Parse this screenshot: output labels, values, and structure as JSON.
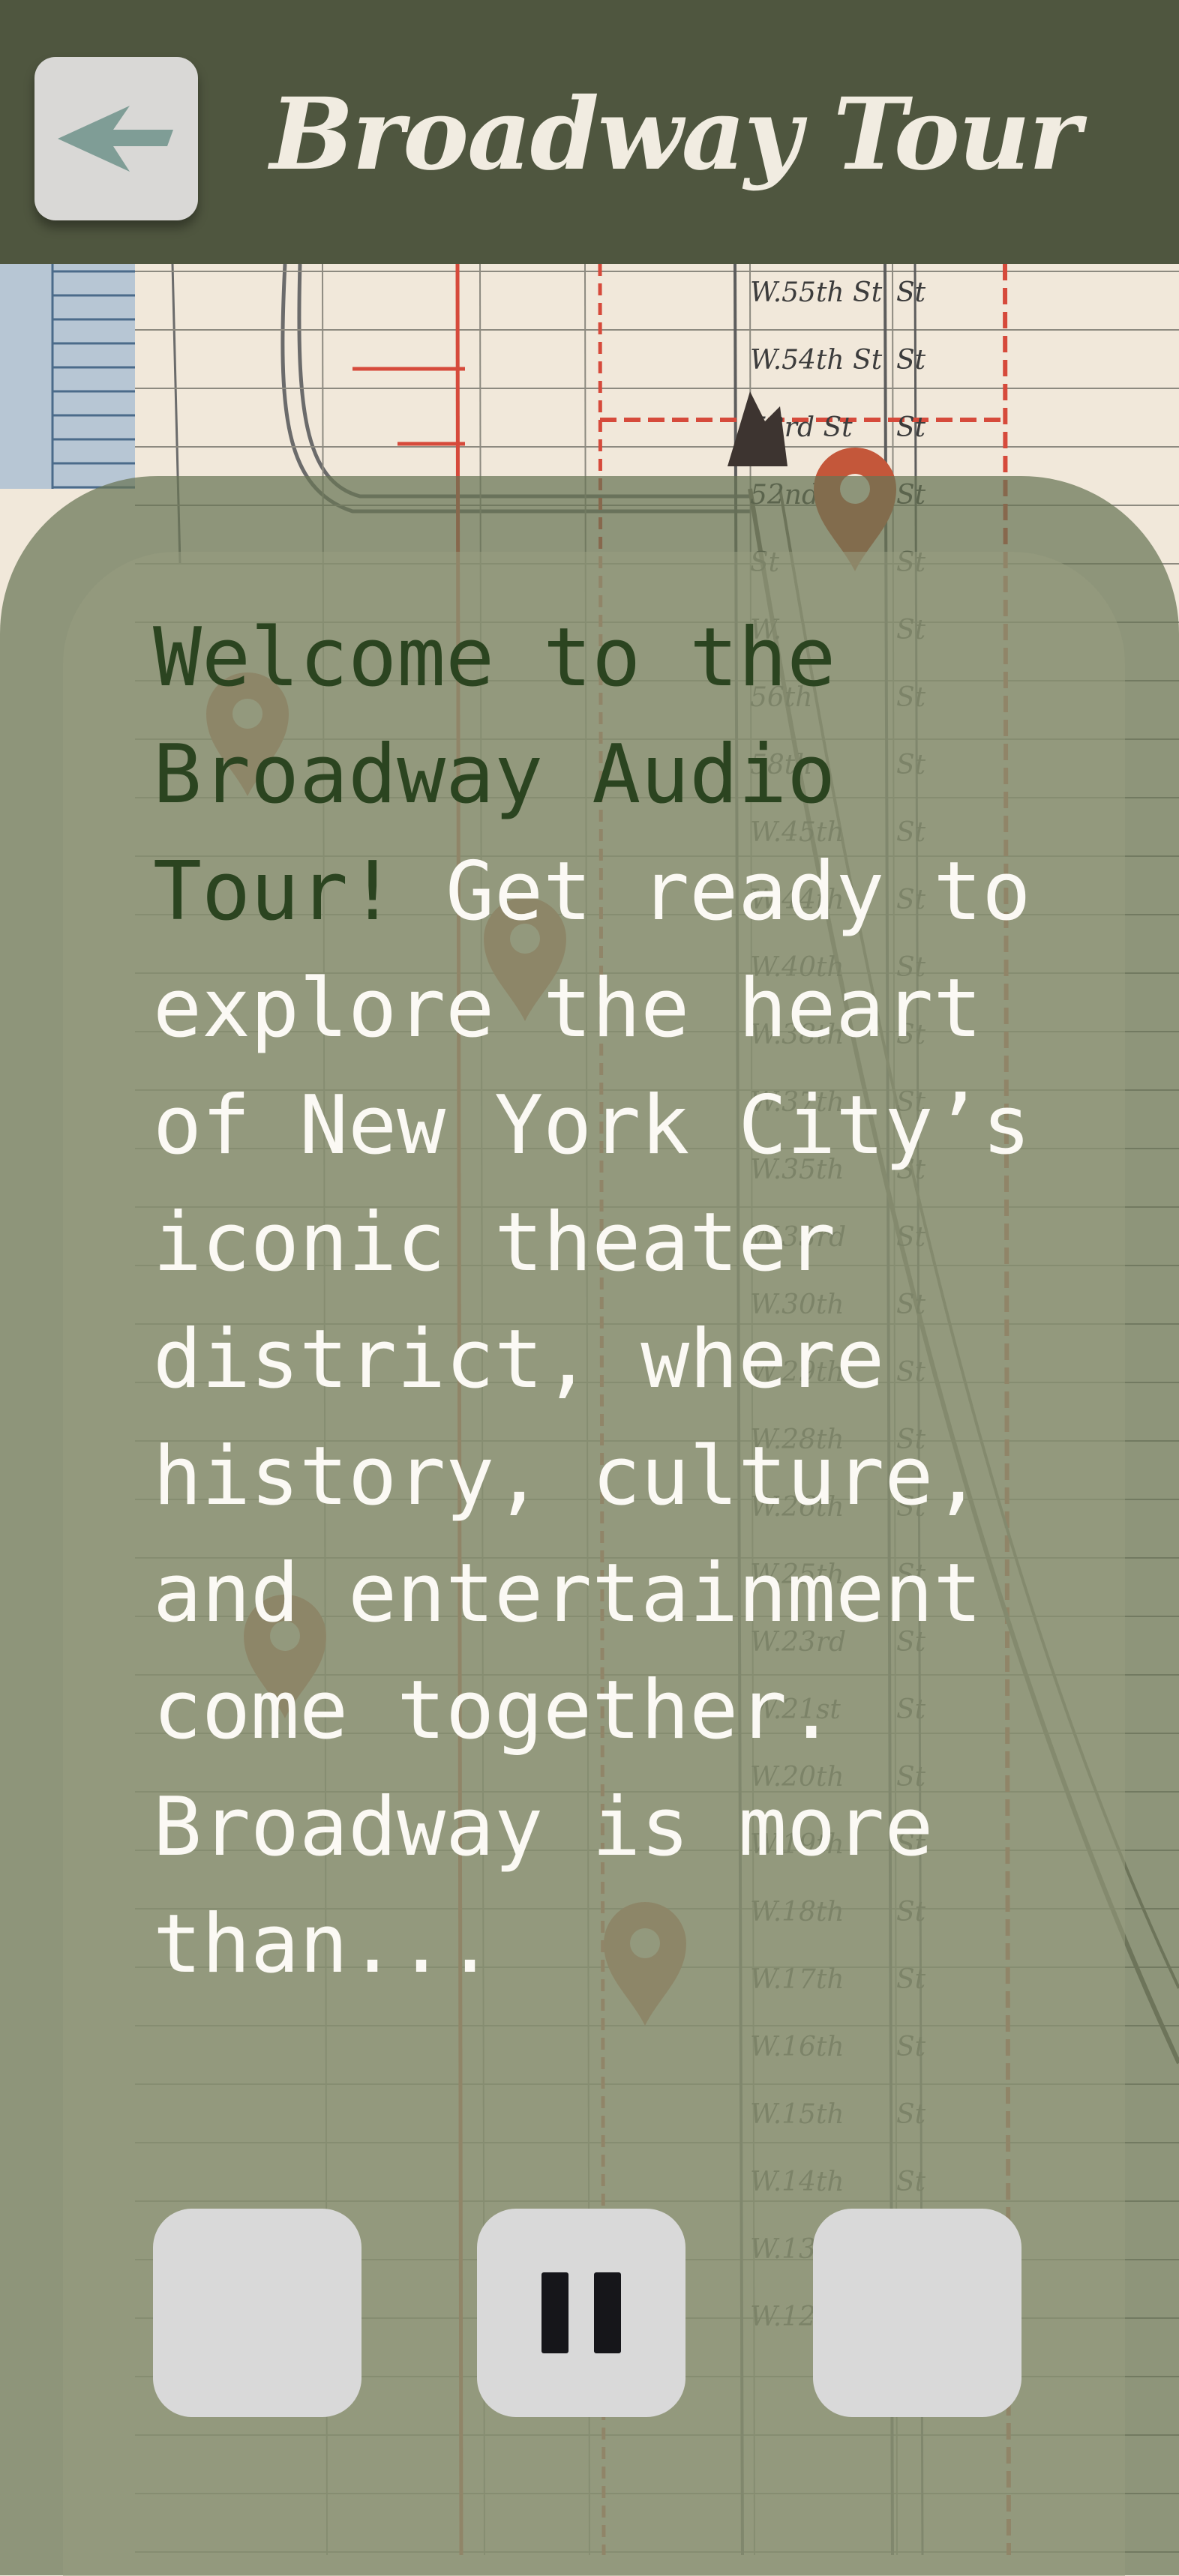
{
  "header": {
    "title": "Broadway Tour",
    "back_icon": "back-arrow-icon"
  },
  "narration": {
    "highlight": "Welcome to the Broadway Audio Tour!",
    "body": " Get ready to explore the heart of New York City’s iconic theater district, where history, culture, and entertainment come together. Broadway is more than..."
  },
  "controls": {
    "previous_icon": "previous-icon",
    "pause_icon": "pause-icon",
    "next_icon": "next-icon"
  },
  "map": {
    "street_labels": [
      "W.55th St",
      "W.54th St",
      "53rd St",
      "52nd St",
      "St",
      "W.",
      "56th",
      "58th",
      "W.45th",
      "W.44th",
      "W.40th",
      "W.38th",
      "W.37th",
      "W.35th",
      "W.33rd",
      "W.30th",
      "W.29th",
      "W.28th",
      "W.26th",
      "W.25th",
      "W.23rd",
      "W.21st",
      "W.20th",
      "W.19th",
      "W.18th",
      "W.17th",
      "W.16th",
      "W.15th",
      "W.14th",
      "W.13th",
      "W.12th St"
    ],
    "pin_icon": "map-pin-icon"
  },
  "colors": {
    "header_bg": "#4f563f",
    "title": "#f1ece1",
    "highlight_text": "#2b4420",
    "body_text": "#fbf9f4",
    "control_bg": "#d9d9d9",
    "map_paper": "#f1e8da",
    "map_street_red": "#d64a3b",
    "pin": "#c4573a"
  }
}
